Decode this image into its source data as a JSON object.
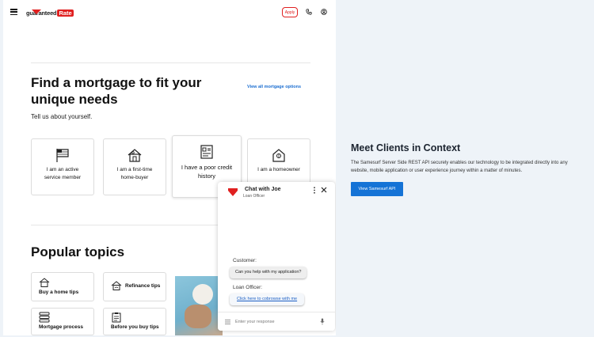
{
  "header": {
    "logo_text": "guaranteed",
    "logo_accent": "Rate",
    "apply_label": "Apply",
    "icons": [
      "hamburger-icon",
      "phone-icon",
      "user-icon"
    ]
  },
  "hero": {
    "title": "Find a mortgage to fit your unique needs",
    "link_label": "View all mortgage options",
    "subtitle": "Tell us about yourself."
  },
  "persona_cards": [
    {
      "label": "I am an active service member",
      "icon": "flag-icon"
    },
    {
      "label": "I am a first-time home-buyer",
      "icon": "house-icon"
    },
    {
      "label": "I have a poor credit history",
      "icon": "credit-report-icon"
    },
    {
      "label": "I am a homeowner",
      "icon": "home-owner-icon"
    }
  ],
  "topics": {
    "title": "Popular topics",
    "items": [
      {
        "label": "Buy a home tips",
        "icon": "home-icon"
      },
      {
        "label": "Refinance tips",
        "icon": "refinance-icon"
      },
      {
        "label": "Mortgage process",
        "icon": "layers-icon"
      },
      {
        "label": "Before you buy tips",
        "icon": "clipboard-icon"
      }
    ]
  },
  "chat": {
    "agent_name": "Chat with Joe",
    "agent_role": "Loan Officer",
    "customer_label": "Customer:",
    "customer_message": "Can you help with my application?",
    "officer_label": "Loan Officer:",
    "officer_link": "Click here to cobrowse with me",
    "input_placeholder": "Enter your response"
  },
  "promo": {
    "title": "Meet Clients in Context",
    "body": "The Samesurf Server Side REST API securely enables our technology to be integrated directly into any website, mobile application or user experience journey within a matter of minutes.",
    "button_label": "View Samesurf API"
  },
  "colors": {
    "brand_red": "#e02020",
    "link_blue": "#1d6fd1",
    "button_blue": "#1573d6",
    "page_bg": "#eef3f8"
  }
}
